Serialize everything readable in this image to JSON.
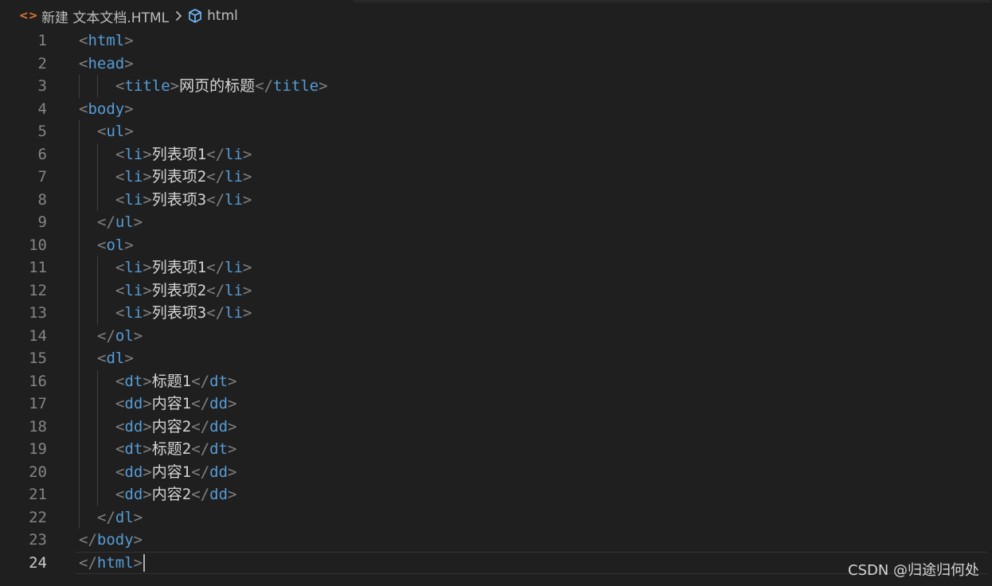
{
  "breadcrumb": {
    "file_icon": "html-file-icon",
    "file": "新建 文本文档.HTML",
    "separator_icon": "chevron-right-icon",
    "symbol_icon": "cube-icon",
    "symbol": "html"
  },
  "colors": {
    "background": "#1f1f1f",
    "tag": "#569cd6",
    "bracket": "#808080",
    "text": "#d4d4d4",
    "line_number": "#858585",
    "file_icon": "#e37933"
  },
  "current_line": 24,
  "lines": [
    {
      "n": "1",
      "indent": 0,
      "tag": "html",
      "close": false,
      "text": ""
    },
    {
      "n": "2",
      "indent": 0,
      "tag": "head",
      "close": false,
      "text": ""
    },
    {
      "n": "3",
      "indent": 2,
      "tag": "title",
      "close": false,
      "text": "网页的标题",
      "end": "title"
    },
    {
      "n": "4",
      "indent": 0,
      "tag": "body",
      "close": false,
      "text": ""
    },
    {
      "n": "5",
      "indent": 1,
      "tag": "ul",
      "close": false,
      "text": ""
    },
    {
      "n": "6",
      "indent": 2,
      "tag": "li",
      "close": false,
      "text": "列表项1",
      "end": "li"
    },
    {
      "n": "7",
      "indent": 2,
      "tag": "li",
      "close": false,
      "text": "列表项2",
      "end": "li"
    },
    {
      "n": "8",
      "indent": 2,
      "tag": "li",
      "close": false,
      "text": "列表项3",
      "end": "li"
    },
    {
      "n": "9",
      "indent": 1,
      "tag": "ul",
      "close": true,
      "text": ""
    },
    {
      "n": "10",
      "indent": 1,
      "tag": "ol",
      "close": false,
      "text": ""
    },
    {
      "n": "11",
      "indent": 2,
      "tag": "li",
      "close": false,
      "text": "列表项1",
      "end": "li"
    },
    {
      "n": "12",
      "indent": 2,
      "tag": "li",
      "close": false,
      "text": "列表项2",
      "end": "li"
    },
    {
      "n": "13",
      "indent": 2,
      "tag": "li",
      "close": false,
      "text": "列表项3",
      "end": "li"
    },
    {
      "n": "14",
      "indent": 1,
      "tag": "ol",
      "close": true,
      "text": ""
    },
    {
      "n": "15",
      "indent": 1,
      "tag": "dl",
      "close": false,
      "text": ""
    },
    {
      "n": "16",
      "indent": 2,
      "tag": "dt",
      "close": false,
      "text": "标题1",
      "end": "dt"
    },
    {
      "n": "17",
      "indent": 2,
      "tag": "dd",
      "close": false,
      "text": "内容1",
      "end": "dd"
    },
    {
      "n": "18",
      "indent": 2,
      "tag": "dd",
      "close": false,
      "text": "内容2",
      "end": "dd"
    },
    {
      "n": "19",
      "indent": 2,
      "tag": "dt",
      "close": false,
      "text": "标题2",
      "end": "dt"
    },
    {
      "n": "20",
      "indent": 2,
      "tag": "dd",
      "close": false,
      "text": "内容1",
      "end": "dd"
    },
    {
      "n": "21",
      "indent": 2,
      "tag": "dd",
      "close": false,
      "text": "内容2",
      "end": "dd"
    },
    {
      "n": "22",
      "indent": 1,
      "tag": "dl",
      "close": true,
      "text": ""
    },
    {
      "n": "23",
      "indent": 0,
      "tag": "body",
      "close": true,
      "text": ""
    },
    {
      "n": "24",
      "indent": 0,
      "tag": "html",
      "close": true,
      "text": ""
    }
  ],
  "watermark": "CSDN @归途归何处"
}
